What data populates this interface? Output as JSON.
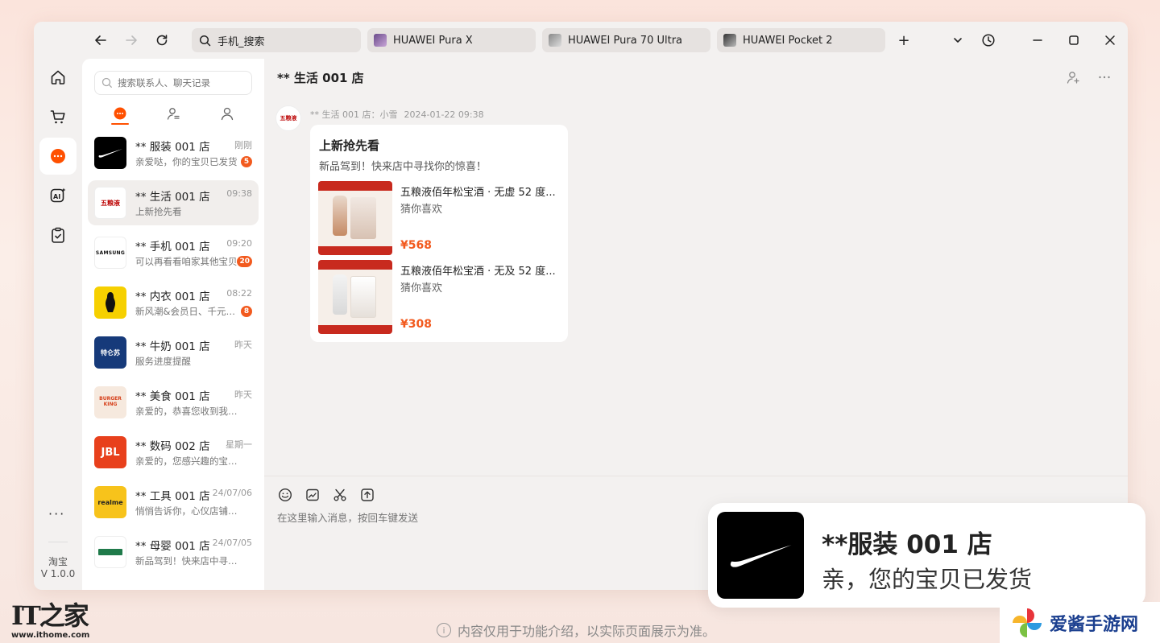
{
  "topbar": {
    "search_tab": "手机_搜索",
    "tabs": [
      {
        "label": "HUAWEI Pura X"
      },
      {
        "label": "HUAWEI Pura 70 Ultra"
      },
      {
        "label": "HUAWEI Pocket 2"
      }
    ],
    "new_tab_label": "+"
  },
  "rail": {
    "app_name": "淘宝",
    "version": "V 1.0.0",
    "more_label": "···"
  },
  "contacts": {
    "search_placeholder": "搜索联系人、聊天记录",
    "items": [
      {
        "name": "** 服装 001 店",
        "time": "刚刚",
        "preview": "亲爱哒，你的宝贝已发货",
        "badge": "5",
        "avatar_text": "",
        "avatar_bg": "#000000"
      },
      {
        "name": "** 生活 001 店",
        "time": "09:38",
        "preview": "上新抢先看",
        "badge": "",
        "avatar_text": "五粮液",
        "avatar_bg": "#ffffff"
      },
      {
        "name": "** 手机 001 店",
        "time": "09:20",
        "preview": "可以再看看咱家其他宝贝",
        "badge": "20",
        "avatar_text": "SAMSUNG",
        "avatar_bg": "#ffffff"
      },
      {
        "name": "** 内衣 001 店",
        "time": "08:22",
        "preview": "新风潮&会员日、千元好礼",
        "badge": "8",
        "avatar_text": "",
        "avatar_bg": "#f6d000"
      },
      {
        "name": "** 牛奶 001 店",
        "time": "昨天",
        "preview": "服务进度提醒",
        "badge": "",
        "avatar_text": "特仑苏",
        "avatar_bg": "#163a7a"
      },
      {
        "name": "** 美食 001 店",
        "time": "昨天",
        "preview": "亲爱的，恭喜您收到我店优惠",
        "badge": "",
        "avatar_text": "BURGER KING",
        "avatar_bg": "#f6e9de"
      },
      {
        "name": "** 数码 002 店",
        "time": "星期一",
        "preview": "亲爱的，您感兴趣的宝贝降价了",
        "badge": "",
        "avatar_text": "JBL",
        "avatar_bg": "#e8401c"
      },
      {
        "name": "** 工具 001 店",
        "time": "24/07/06",
        "preview": "悄悄告诉你，心仪店铺上新了",
        "badge": "",
        "avatar_text": "realme",
        "avatar_bg": "#f7c31b"
      },
      {
        "name": "** 母婴 001 店",
        "time": "24/07/05",
        "preview": "新品驾到！快来店中寻找你的惊喜",
        "badge": "",
        "avatar_text": "",
        "avatar_bg": "#ffffff"
      }
    ]
  },
  "chat": {
    "title": "** 生活 001 店",
    "title_arrow": "›",
    "sender": "** 生活 001 店：小雪",
    "datetime": "2024-01-22 09:38",
    "card": {
      "title": "上新抢先看",
      "subtitle": "新品驾到！快来店中寻找你的惊喜！",
      "products": [
        {
          "name": "五粮液佰年松宝酒 · 无虚 52 度...",
          "tag": "猜你喜欢",
          "price": "¥568"
        },
        {
          "name": "五粮液佰年松宝酒 · 无及 52 度...",
          "tag": "猜你喜欢",
          "price": "¥308"
        }
      ]
    },
    "input_placeholder": "在这里输入消息，按回车键发送"
  },
  "notification": {
    "title": "**服装 001 店",
    "body": "亲，您的宝贝已发货"
  },
  "footer": {
    "notice": "内容仅用于功能介绍，以实际页面展示为准。"
  },
  "watermarks": {
    "left_url": "www.ithome.com",
    "right_text": "爱酱手游网"
  },
  "colors": {
    "accent": "#ff5000",
    "badge": "#f25a1e",
    "price": "#f25a1e"
  }
}
